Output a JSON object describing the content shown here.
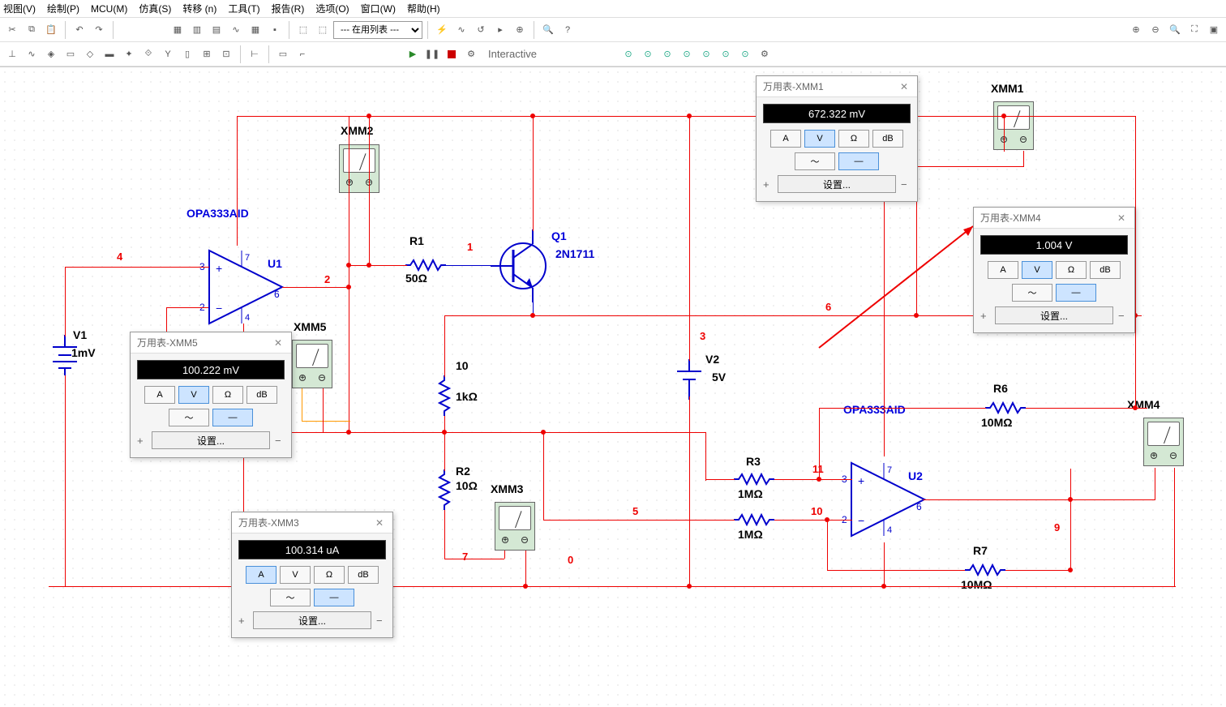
{
  "menu": {
    "view": "视图(V)",
    "draw": "绘制(P)",
    "mcu": "MCU(M)",
    "sim": "仿真(S)",
    "xfer": "转移 (n)",
    "tools": "工具(T)",
    "report": "报告(R)",
    "options": "选项(O)",
    "window": "窗口(W)",
    "help": "帮助(H)"
  },
  "toolbar": {
    "sim_label": "Interactive",
    "list_dropdown": "--- 在用列表 ---"
  },
  "multimeters": {
    "xmm1": {
      "title": "万用表-XMM1",
      "reading": "672.322 mV",
      "mode": "V",
      "wave": "dc",
      "settings": "设置..."
    },
    "xmm3": {
      "title": "万用表-XMM3",
      "reading": "100.314 uA",
      "mode": "A",
      "wave": "dc",
      "settings": "设置..."
    },
    "xmm4": {
      "title": "万用表-XMM4",
      "reading": "1.004 V",
      "mode": "V",
      "wave": "dc",
      "settings": "设置..."
    },
    "xmm5": {
      "title": "万用表-XMM5",
      "reading": "100.222 mV",
      "mode": "V",
      "wave": "dc",
      "settings": "设置..."
    }
  },
  "mm_buttons": {
    "A": "A",
    "V": "V",
    "Ohm": "Ω",
    "dB": "dB"
  },
  "instruments": {
    "xmm1": "XMM1",
    "xmm2": "XMM2",
    "xmm3": "XMM3",
    "xmm4": "XMM4",
    "xmm5": "XMM5"
  },
  "components": {
    "U1": {
      "ref": "U1",
      "model": "OPA333AID"
    },
    "U2": {
      "ref": "U2",
      "model": "OPA333AID"
    },
    "Q1": {
      "ref": "Q1",
      "model": "2N1711"
    },
    "V1": {
      "ref": "V1",
      "val": "1mV"
    },
    "V2": {
      "ref": "V2",
      "val": "5V"
    },
    "R1": {
      "ref": "R1",
      "val": "50Ω"
    },
    "R2": {
      "ref": "R2",
      "val": "10Ω"
    },
    "R3": {
      "ref": "R3",
      "val": "1MΩ"
    },
    "R4": {
      "ref": "",
      "val": "1MΩ"
    },
    "R5": {
      "ref": "10",
      "val": "1kΩ"
    },
    "R6": {
      "ref": "R6",
      "val": "10MΩ"
    },
    "R7": {
      "ref": "R7",
      "val": "10MΩ"
    }
  },
  "nets": {
    "n0": "0",
    "n1": "1",
    "n2": "2",
    "n3": "3",
    "n4": "4",
    "n5": "5",
    "n6": "6",
    "n7": "7",
    "n9": "9",
    "n10": "10",
    "n11": "11"
  }
}
